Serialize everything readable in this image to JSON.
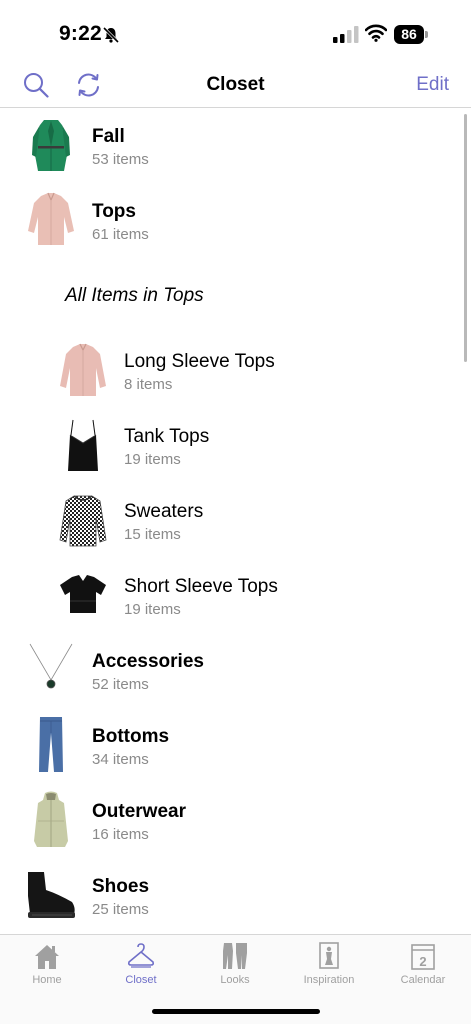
{
  "status_bar": {
    "time": "9:22",
    "battery": "86"
  },
  "nav": {
    "title": "Closet",
    "edit_label": "Edit"
  },
  "section_label": "All Items in Tops",
  "categories_top": [
    {
      "title": "Fall",
      "count": "53 items",
      "icon": "green-coat-thumbnail"
    },
    {
      "title": "Tops",
      "count": "61 items",
      "icon": "pink-shirt-thumbnail"
    }
  ],
  "subcategories": [
    {
      "title": "Long Sleeve Tops",
      "count": "8 items",
      "icon": "pink-blouse-thumbnail"
    },
    {
      "title": "Tank Tops",
      "count": "19 items",
      "icon": "black-tank-thumbnail"
    },
    {
      "title": "Sweaters",
      "count": "15 items",
      "icon": "checkered-sweater-thumbnail"
    },
    {
      "title": "Short Sleeve Tops",
      "count": "19 items",
      "icon": "black-tee-thumbnail"
    }
  ],
  "categories_bottom": [
    {
      "title": "Accessories",
      "count": "52 items",
      "icon": "necklace-thumbnail"
    },
    {
      "title": "Bottoms",
      "count": "34 items",
      "icon": "jeans-thumbnail"
    },
    {
      "title": "Outerwear",
      "count": "16 items",
      "icon": "parka-thumbnail"
    },
    {
      "title": "Shoes",
      "count": "25 items",
      "icon": "boot-thumbnail"
    }
  ],
  "tabs": [
    {
      "label": "Home",
      "icon": "house-icon"
    },
    {
      "label": "Closet",
      "icon": "hanger-icon",
      "active": true
    },
    {
      "label": "Looks",
      "icon": "outfit-icon"
    },
    {
      "label": "Inspiration",
      "icon": "mannequin-icon"
    },
    {
      "label": "Calendar",
      "icon": "calendar-icon",
      "calendar_day": "2"
    }
  ],
  "colors": {
    "accent": "#6f6fc8",
    "secondary_text": "#8a8a8a",
    "divider": "#d6d6d6"
  }
}
